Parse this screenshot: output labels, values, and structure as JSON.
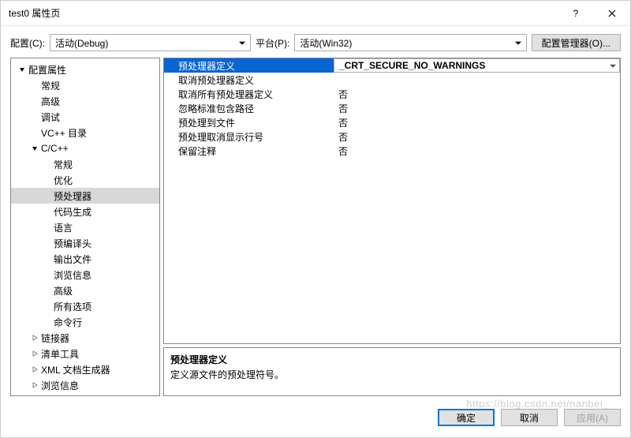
{
  "window": {
    "title": "test0 属性页"
  },
  "config": {
    "config_label": "配置(C):",
    "config_value": "活动(Debug)",
    "platform_label": "平台(P):",
    "platform_value": "活动(Win32)",
    "manager_btn": "配置管理器(O)..."
  },
  "tree": {
    "root": "配置属性",
    "l1": [
      "常规",
      "高级",
      "调试",
      "VC++ 目录"
    ],
    "ccpp": "C/C++",
    "ccpp_children": [
      "常规",
      "优化",
      "预处理器",
      "代码生成",
      "语言",
      "预编译头",
      "输出文件",
      "浏览信息",
      "高级",
      "所有选项",
      "命令行"
    ],
    "rest": [
      "链接器",
      "清单工具",
      "XML 文档生成器",
      "浏览信息"
    ]
  },
  "props": [
    {
      "name": "预处理器定义",
      "value": "_CRT_SECURE_NO_WARNINGS"
    },
    {
      "name": "取消预处理器定义",
      "value": ""
    },
    {
      "name": "取消所有预处理器定义",
      "value": "否"
    },
    {
      "name": "忽略标准包含路径",
      "value": "否"
    },
    {
      "name": "预处理到文件",
      "value": "否"
    },
    {
      "name": "预处理取消显示行号",
      "value": "否"
    },
    {
      "name": "保留注释",
      "value": "否"
    }
  ],
  "desc": {
    "title": "预处理器定义",
    "body": "定义源文件的预处理符号。"
  },
  "buttons": {
    "ok": "确定",
    "cancel": "取消",
    "apply": "应用(A)"
  },
  "watermark": "https://blog.csdn.net/nanbei_"
}
